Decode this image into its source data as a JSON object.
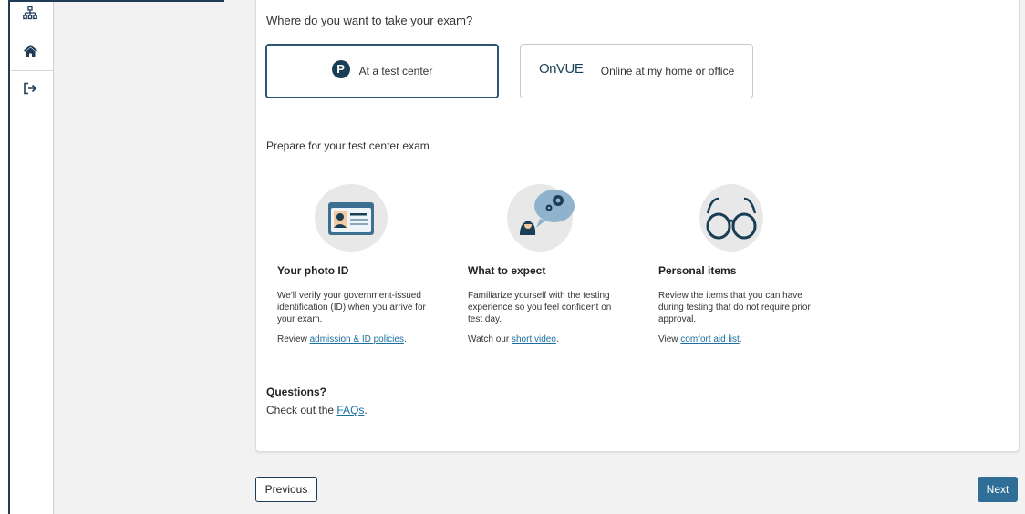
{
  "sidebar": {
    "icons": [
      "sitemap-icon",
      "home-icon",
      "sign-out-icon"
    ]
  },
  "question": "Where do you want to take your exam?",
  "options": {
    "test_center": {
      "logo": "P",
      "label": "At a test center"
    },
    "online": {
      "logo_text": "OnVUE",
      "label": "Online at my home or office"
    }
  },
  "prepare_heading": "Prepare for your test center exam",
  "columns": [
    {
      "title": "Your photo ID",
      "body": "We'll verify your government-issued identification (ID) when you arrive for your exam.",
      "link_prefix": "Review ",
      "link_text": "admission & ID policies",
      "link_suffix": "."
    },
    {
      "title": "What to expect",
      "body": "Familiarize yourself with the testing experience so you feel confident on test day.",
      "link_prefix": "Watch our ",
      "link_text": "short video",
      "link_suffix": "."
    },
    {
      "title": "Personal items",
      "body": "Review the items that you can have during testing that do not require prior approval.",
      "link_prefix": "View ",
      "link_text": "comfort aid list",
      "link_suffix": "."
    }
  ],
  "questions": {
    "heading": "Questions?",
    "prefix": "Check out the ",
    "link_text": "FAQs",
    "suffix": "."
  },
  "buttons": {
    "previous": "Previous",
    "next": "Next"
  },
  "colors": {
    "accent": "#2f6f97",
    "navy": "#1a3e55",
    "link": "#1a6fa0"
  }
}
